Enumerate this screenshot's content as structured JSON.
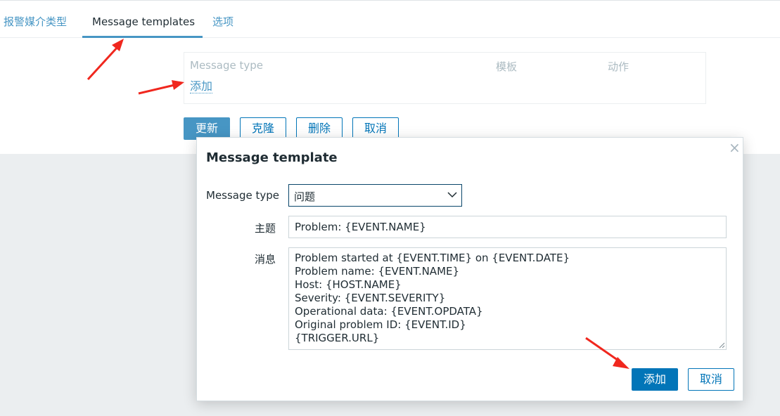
{
  "tabs": [
    {
      "label": "报警媒介类型"
    },
    {
      "label": "Message templates"
    },
    {
      "label": "选项"
    }
  ],
  "templates_table": {
    "headers": [
      "Message type",
      "模板",
      "动作"
    ],
    "add_link": "添加"
  },
  "form_buttons": {
    "update": "更新",
    "clone": "克隆",
    "delete": "删除",
    "cancel": "取消"
  },
  "modal": {
    "title": "Message template",
    "close_icon": "close-icon",
    "message_type_label": "Message type",
    "message_type_value": "问题",
    "subject_label": "主题",
    "subject_value": "Problem: {EVENT.NAME}",
    "message_label": "消息",
    "message_lines": [
      "Problem started at {EVENT.TIME} on {EVENT.DATE}",
      "Problem name: {EVENT.NAME}",
      "Host: {HOST.NAME}",
      "Severity: {EVENT.SEVERITY}",
      "Operational data: {EVENT.OPDATA}",
      "Original problem ID: {EVENT.ID}",
      "{TRIGGER.URL}"
    ],
    "add_button": "添加",
    "cancel_button": "取消"
  },
  "colors": {
    "accent": "#4796c4",
    "primary_button": "#0275b8",
    "annotation_arrow": "#f0271e"
  }
}
